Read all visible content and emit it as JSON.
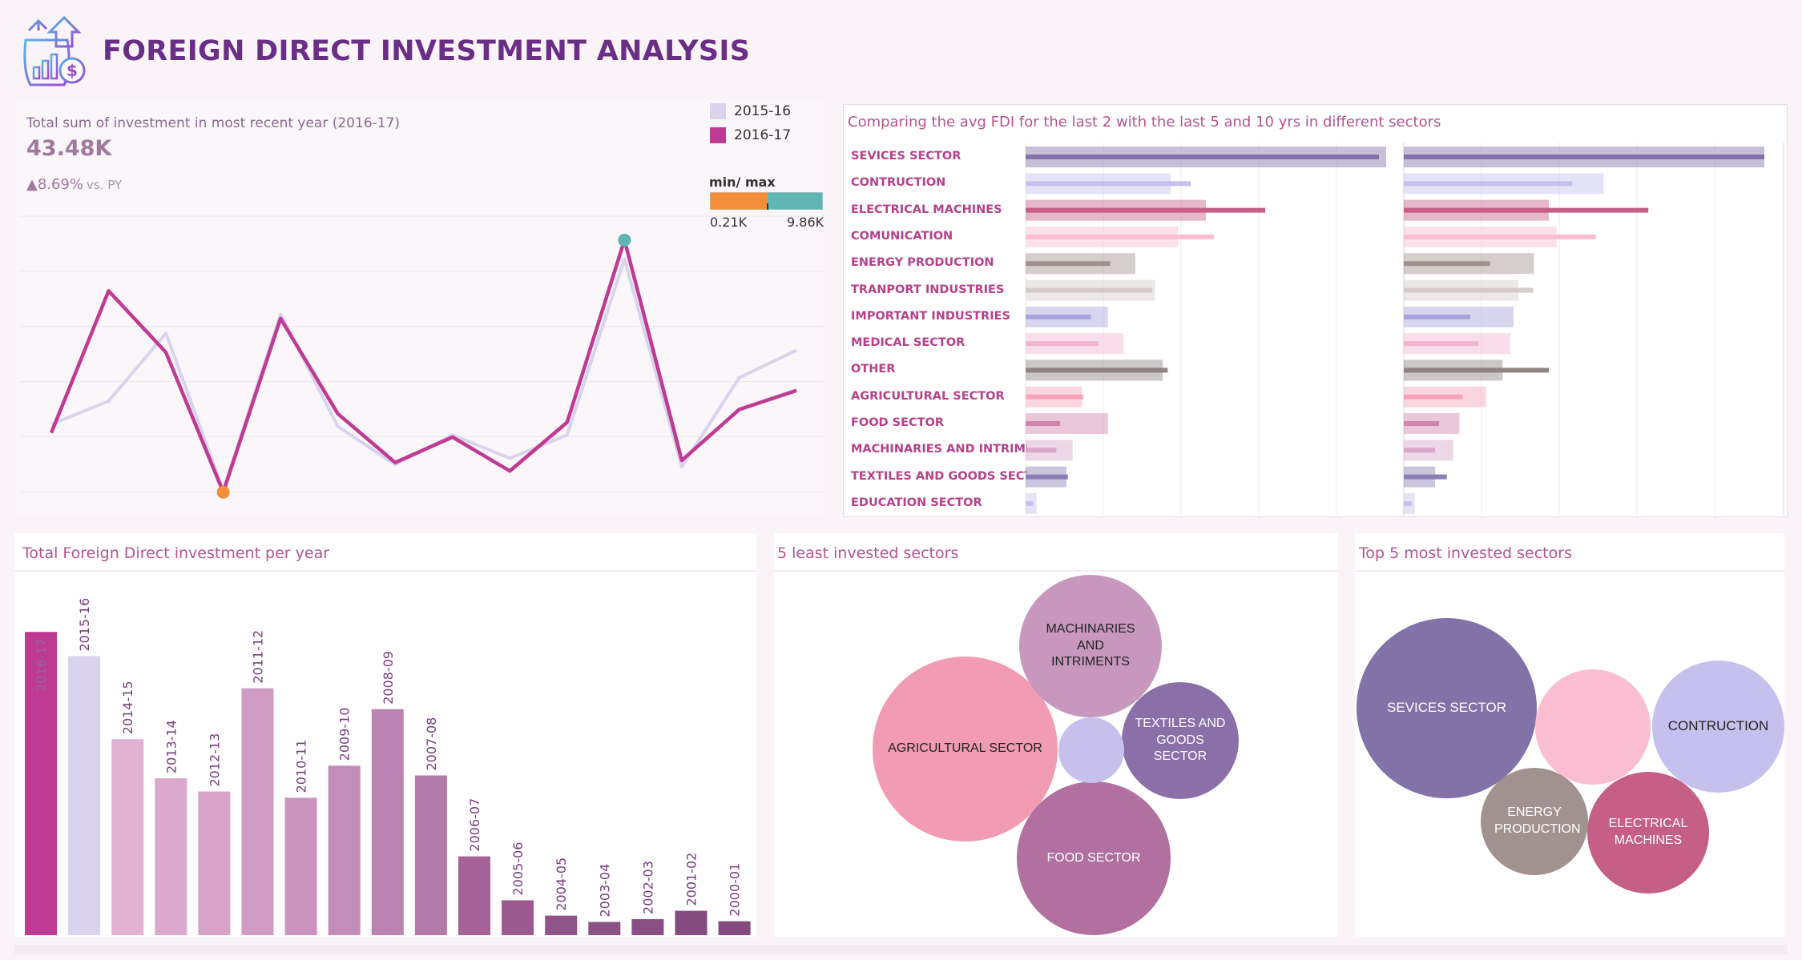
{
  "header": {
    "title": "FOREIGN DIRECT INVESTMENT ANALYSIS",
    "logo_icon": "money-bag-growth-icon"
  },
  "kpi": {
    "label": "Total sum of investment in most recent year (2016-17)",
    "value": "43.48K",
    "delta": "▲8.69%",
    "delta_suffix": "vs. PY"
  },
  "legend": {
    "items": [
      {
        "label": "2015-16",
        "color": "#d9d3ee"
      },
      {
        "label": "2016-17",
        "color": "#bf3a93"
      }
    ],
    "minmax_label": "min/ max",
    "min": "0.21K",
    "max": "9.86K",
    "min_color": "#f28e3a",
    "max_color": "#5fb6b3"
  },
  "sector_chart": {
    "title": "Comparing the avg FDI for the last 2  with the last 5  and 10 yrs in different sectors",
    "sectors": [
      "SEVICES SECTOR",
      "CONTRUCTION",
      "ELECTRICAL MACHINES",
      "COMUNICATION",
      "ENERGY PRODUCTION",
      "TRANPORT INDUSTRIES",
      "IMPORTANT  INDUSTRIES",
      "MEDICAL SECTOR",
      "OTHER",
      "AGRICULTURAL SECTOR",
      "FOOD SECTOR",
      "MACHINARIES AND INTRIMEN..",
      "TEXTILES AND GOODS SECTOR",
      "EDUCATION SECTOR"
    ]
  },
  "year_chart": {
    "title": "Total Foreign Direct  investment per year"
  },
  "least_bubbles": {
    "title": "5 least invested sectors",
    "items": [
      {
        "label": "AGRICULTURAL SECTOR",
        "color": "#f19bb5",
        "text_color": "#222"
      },
      {
        "label": "MACHINARIES AND INTRIMENTS",
        "color": "#c797bd",
        "text_color": "#222"
      },
      {
        "label": "TEXTILES AND GOODS SECTOR",
        "color": "#8a6fa8",
        "text_color": "#fff"
      },
      {
        "label": "FOOD SECTOR",
        "color": "#b170a0",
        "text_color": "#fff"
      },
      {
        "label": "",
        "color": "#c7c0ec",
        "text_color": "#222"
      }
    ]
  },
  "top_bubbles": {
    "title": "Top 5 most invested sectors",
    "items": [
      {
        "label": "SEVICES SECTOR",
        "color": "#8272a8",
        "text_color": "#fff"
      },
      {
        "label": "",
        "color": "#fbbdd1",
        "text_color": "#222"
      },
      {
        "label": "CONTRUCTION",
        "color": "#c6c0ee",
        "text_color": "#222"
      },
      {
        "label": "ENERGY PRODUCTION",
        "color": "#a2928f",
        "text_color": "#fff"
      },
      {
        "label": "ELECTRICAL MACHINES",
        "color": "#c65f86",
        "text_color": "#fff"
      }
    ]
  },
  "chart_data": [
    {
      "type": "line",
      "series": [
        {
          "name": "2015-16",
          "values": [
            3.4,
            4.5,
            7.7,
            0.3,
            8.6,
            3.3,
            1.5,
            2.9,
            1.8,
            2.9,
            11.2,
            1.4,
            5.6,
            6.9
          ],
          "color": "#d9d3ee"
        },
        {
          "name": "2016-17",
          "values": [
            3.0,
            9.7,
            6.8,
            0.2,
            8.4,
            3.9,
            1.6,
            2.8,
            1.2,
            3.5,
            12.1,
            1.7,
            4.1,
            5.0
          ],
          "color": "#bf3a93"
        }
      ],
      "ylim": [
        0,
        13
      ],
      "grid": true,
      "max_marker": "9.86K",
      "min_marker": "0.21K"
    },
    {
      "type": "bar",
      "panels": [
        "last 5 yrs",
        "last 10 yrs"
      ],
      "categories": [
        "SEVICES SECTOR",
        "CONTRUCTION",
        "ELECTRICAL MACHINES",
        "COMUNICATION",
        "ENERGY PRODUCTION",
        "TRANPORT INDUSTRIES",
        "IMPORTANT  INDUSTRIES",
        "MEDICAL SECTOR",
        "OTHER",
        "AGRICULTURAL SECTOR",
        "FOOD SECTOR",
        "MACHINARIES AND INTRIMEN..",
        "TEXTILES AND GOODS SECTOR",
        "EDUCATION SECTOR"
      ],
      "colors": [
        "#8272a8",
        "#c6c0ee",
        "#c65f86",
        "#fbbdd1",
        "#a2928f",
        "#d3cbc9",
        "#a9a3dc",
        "#f2b4d0",
        "#8f8282",
        "#f7a3bb",
        "#d086ac",
        "#d9a9cb",
        "#8c7fb6",
        "#c7c0ec"
      ],
      "series": [
        {
          "name": "last 2 yrs",
          "values": [
            460,
            215,
            312,
            245,
            110,
            165,
            85,
            95,
            185,
            75,
            45,
            40,
            55,
            10
          ]
        },
        {
          "name": "last 5 yrs",
          "values": [
            460,
            185,
            230,
            195,
            140,
            165,
            105,
            125,
            175,
            72,
            105,
            60,
            52,
            14
          ]
        },
        {
          "name": "last 10 yrs",
          "values": [
            460,
            255,
            185,
            195,
            166,
            146,
            140,
            136,
            126,
            105,
            71,
            63,
            40,
            14
          ]
        }
      ]
    },
    {
      "type": "bar",
      "categories": [
        "2016-17",
        "2015-16",
        "2014-15",
        "2013-14",
        "2012-13",
        "2011-12",
        "2010-11",
        "2009-10",
        "2008-09",
        "2007-08",
        "2006-07",
        "2005-06",
        "2004-05",
        "2003-04",
        "2002-03",
        "2001-02",
        "2000-01"
      ],
      "values": [
        43.48,
        40.0,
        28.1,
        22.5,
        20.6,
        35.4,
        19.7,
        24.3,
        32.4,
        22.9,
        11.3,
        5.0,
        2.8,
        1.9,
        2.3,
        3.5,
        2.0
      ],
      "colors": [
        "#bf3a93",
        "#d9d3ee",
        "#e2b2d3",
        "#dba9cc",
        "#d8a3c8",
        "#cf9cc3",
        "#c994bd",
        "#c28db8",
        "#ba84b2",
        "#b27aa8",
        "#a56399",
        "#9a5a8f",
        "#8f5489",
        "#8a5386",
        "#874f83",
        "#844b80",
        "#834a7f"
      ],
      "ylim": [
        0,
        45
      ]
    }
  ]
}
